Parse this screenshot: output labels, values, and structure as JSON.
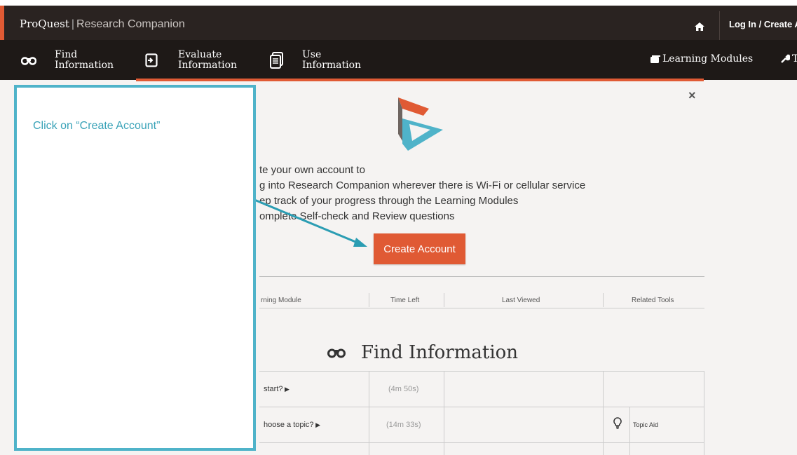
{
  "header": {
    "brand_name": "ProQuest",
    "brand_sep": "|",
    "brand_product": "Research Companion",
    "login_label": "Log In / Create A"
  },
  "nav": {
    "find": {
      "line1": "Find",
      "line2": "Information"
    },
    "evaluate": {
      "line1": "Evaluate",
      "line2": "Information"
    },
    "use": {
      "line1": "Use",
      "line2": "Information"
    },
    "learning_modules": "Learning Modules",
    "tools_partial": "T"
  },
  "modal": {
    "close": "×",
    "intro_lines": [
      "te your own account to",
      "g into Research Companion wherever there is Wi-Fi or cellular service",
      "ep track of your progress through the Learning Modules",
      "omplete Self-check and Review questions"
    ],
    "create_button": "Create Account"
  },
  "table": {
    "headers": [
      "rning Module",
      "Time Left",
      "Last Viewed",
      "Related Tools"
    ],
    "section_title": "Find Information",
    "rows": [
      {
        "module": "start?",
        "time": "(4m 50s)",
        "last": "",
        "tool": ""
      },
      {
        "module": "hoose a topic?",
        "time": "(14m 33s)",
        "last": "",
        "tool": "Topic Aid"
      }
    ]
  },
  "overlay": {
    "instruction": "Click on “Create Account”"
  },
  "colors": {
    "accent": "#e05a34",
    "topbar": "#2a2321",
    "navbar": "#1e1917",
    "overlay_border": "#4fb3c9",
    "teal": "#3aa3b8"
  }
}
